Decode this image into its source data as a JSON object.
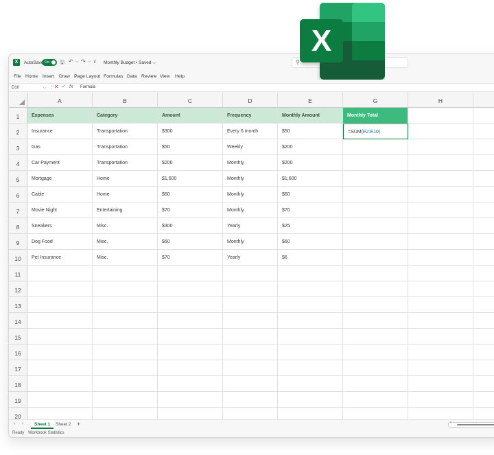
{
  "titlebar": {
    "app_icon": "X",
    "autosave_label": "AutoSave",
    "toggle_label": "On",
    "doc_title": "Monthly Budget • Saved ⌵"
  },
  "menu": [
    "File",
    "Home",
    "Insert",
    "Draw",
    "Page Layout",
    "Formulas",
    "Data",
    "Review",
    "View",
    "Help"
  ],
  "formula_bar": {
    "name_box": "D10",
    "formula_text": "Formula"
  },
  "columns": [
    "A",
    "B",
    "C",
    "D",
    "E",
    "G",
    "H"
  ],
  "rows": [
    "1",
    "2",
    "3",
    "4",
    "5",
    "6",
    "7",
    "8",
    "9",
    "10",
    "11",
    "12",
    "13",
    "14",
    "15",
    "16",
    "17",
    "18",
    "19",
    "20"
  ],
  "table": {
    "headers": [
      "Expenses",
      "Category",
      "Amount",
      "Frequency",
      "Monthly Amount",
      "Monthly Total"
    ],
    "rows": [
      [
        "Insurance",
        "Transportation",
        "$300",
        "Every 6 month",
        "$50"
      ],
      [
        "Gas",
        "Transportation",
        "$50",
        "Weekly",
        "$200"
      ],
      [
        "Car Payment",
        "Transportation",
        "$200",
        "Monthly",
        "$200"
      ],
      [
        "Mortgage",
        "Home",
        "$1,600",
        "Monthly",
        "$1,600"
      ],
      [
        "Cable",
        "Home",
        "$60",
        "Monthly",
        "$60"
      ],
      [
        "Movie Night",
        "Entertaining",
        "$70",
        "Monthly",
        "$70"
      ],
      [
        "Sneakers",
        "Misc.",
        "$300",
        "Yearly",
        "$25"
      ],
      [
        "Dog Food",
        "Misc.",
        "$60",
        "Monthly",
        "$60"
      ],
      [
        "Pet Insurance",
        "Misc.",
        "$70",
        "Yearly",
        "$6"
      ]
    ],
    "active_formula_fn": "=SUM(",
    "active_formula_ref": "E2:E10",
    "active_formula_close": ")"
  },
  "sheets": [
    "Sheet 1",
    "Sheet 2"
  ],
  "add_sheet": "+",
  "status": {
    "ready": "Ready",
    "workbook_stats": "Workbook Statistics"
  },
  "logo": {
    "letter": "X"
  },
  "colors": {
    "accent": "#107c41",
    "header_fill": "#cce8d6",
    "active_header_fill": "#3dbb7f",
    "reference": "#1c6fb8"
  }
}
